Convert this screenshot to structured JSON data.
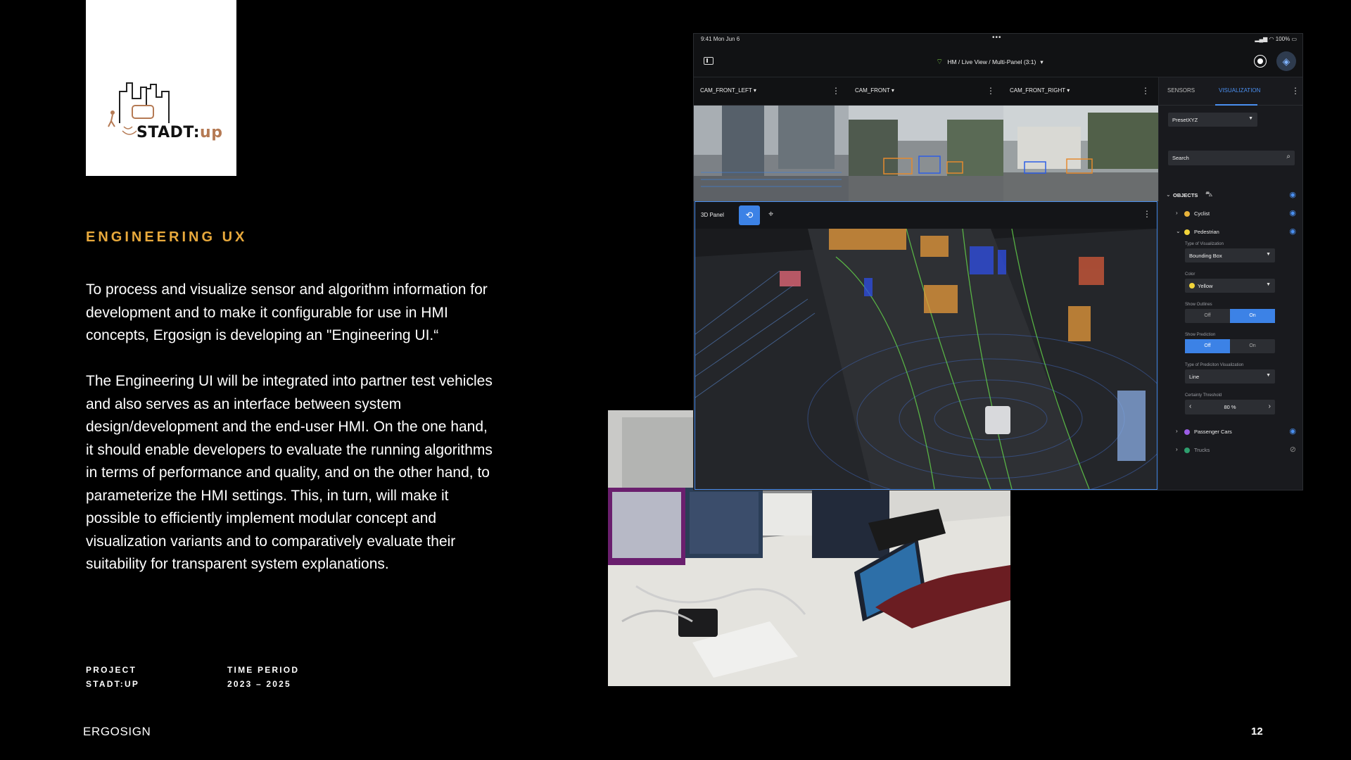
{
  "logo": {
    "word_main": "STADT:",
    "word_accent": "up"
  },
  "section_title": "ENGINEERING UX",
  "paragraphs": [
    "To process and visualize sensor and algorithm information for development and to make it configurable for use in HMI concepts, Ergosign is developing an \"Engineering UI.“",
    "The Engineering UI will be integrated into partner test vehicles and also serves as an interface between system design/development and the end-user HMI. On the one hand, it should enable developers to evaluate the running algorithms in terms of performance and quality, and on the other hand, to parameterize the HMI settings. This, in turn, will make it possible to efficiently implement modular concept and visualization variants and to comparatively evaluate their suitability for transparent system explanations."
  ],
  "meta": {
    "project_label": "PROJECT",
    "project_value": "STADT:UP",
    "period_label": "TIME PERIOD",
    "period_value": "2023 – 2025"
  },
  "brand": "ERGOSIGN",
  "page_number": "12",
  "tablet": {
    "status_time": "9:41  Mon Jun 6",
    "status_dots": "•••",
    "status_battery": "100%",
    "breadcrumb": "HM / Live View / Multi-Panel (3:1)",
    "cameras": [
      "CAM_FRONT_LEFT",
      "CAM_FRONT",
      "CAM_FRONT_RIGHT"
    ],
    "panel_title": "3D Panel",
    "tabs": [
      "SENSORS",
      "VISUALIZATION"
    ],
    "active_tab": "VISUALIZATION",
    "preset": "PresetXYZ",
    "search_placeholder": "Search",
    "objects_label": "OBJECTS",
    "items": {
      "cyclist": "Cyclist",
      "pedestrian": "Pedestrian",
      "passenger_cars": "Passenger Cars",
      "trucks": "Trucks"
    },
    "pedestrian_settings": {
      "vis_type_label": "Type of Visualization",
      "vis_type_value": "Bounding Box",
      "color_label": "Color",
      "color_value": "Yellow",
      "outlines_label": "Show Outlines",
      "prediction_label": "Show Prediction",
      "off": "Off",
      "on": "On",
      "pred_type_label": "Type of Prediciton Visualization",
      "pred_type_value": "Line",
      "threshold_label": "Certainty Threshold",
      "threshold_value": "80  %"
    },
    "colors": {
      "accent": "#3c82e6",
      "cyclist": "#e8b33a",
      "pedestrian": "#f2d43a",
      "passenger_cars": "#9b5de5",
      "trucks": "#2e9e6e"
    }
  }
}
